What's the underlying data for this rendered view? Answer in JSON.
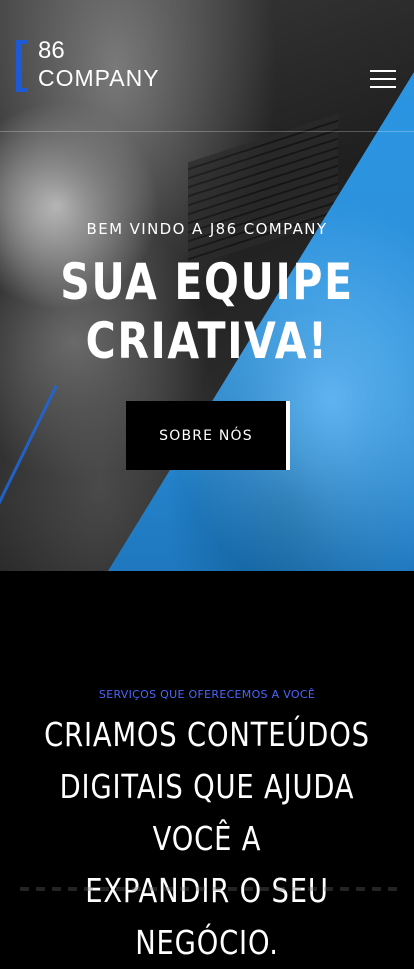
{
  "brand": {
    "logo_top": "86",
    "logo_bottom": "COMPANY"
  },
  "header": {
    "menu_icon": "hamburger-menu-icon"
  },
  "hero": {
    "subtitle": "BEM VINDO A J86 COMPANY",
    "title_line1": "SUA EQUIPE",
    "title_line2": "CRIATIVA!",
    "cta_label": "SOBRE NÓS"
  },
  "services": {
    "eyebrow": "SERVIÇOS QUE OFERECEMOS A VOCÊ",
    "title_line1": "CRIAMOS CONTEÚDOS",
    "title_line2": "DIGITAIS QUE AJUDA VOCÊ A",
    "title_line3": "EXPANDIR O SEU NEGÓCIO."
  },
  "colors": {
    "accent_blue": "#2b97e6",
    "brand_blue": "#1f5ad6",
    "eyebrow_blue": "#4a66ff"
  }
}
